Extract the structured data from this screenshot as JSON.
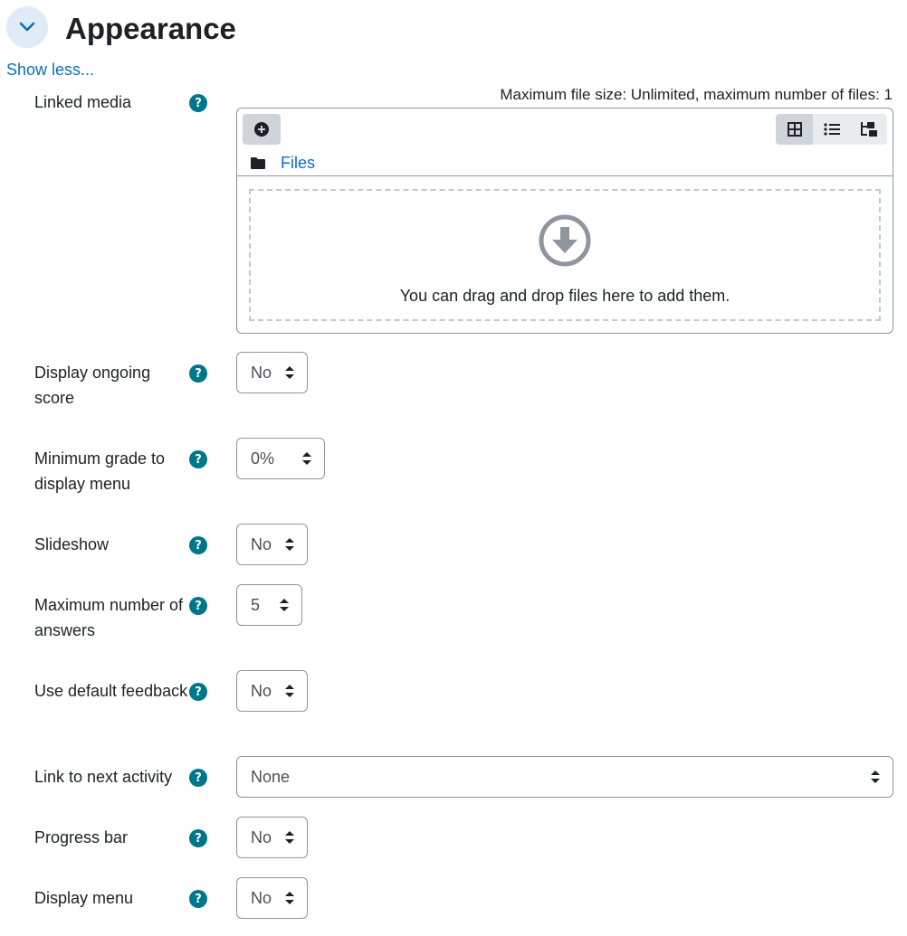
{
  "section": {
    "title": "Appearance",
    "show_less": "Show less...",
    "collapse_icon": "chevron-down-icon"
  },
  "linked_media": {
    "label": "Linked media",
    "max_info": "Maximum file size: Unlimited, maximum number of files: 1",
    "path_label": "Files",
    "drop_text": "You can drag and drop files here to add them.",
    "icons": [
      "add-file-icon",
      "grid-view-icon",
      "list-view-icon",
      "tree-view-icon",
      "folder-icon",
      "download-arrow-icon"
    ]
  },
  "fields": [
    {
      "label": "Display ongoing score",
      "value": "No"
    },
    {
      "label": "Minimum grade to display menu",
      "value": "0%"
    },
    {
      "label": "Slideshow",
      "value": "No"
    },
    {
      "label": "Maximum number of answers",
      "value": "5"
    },
    {
      "label": "Use default feedback",
      "value": "No"
    },
    {
      "label": "Link to next activity",
      "value": "None"
    },
    {
      "label": "Progress bar",
      "value": "No"
    },
    {
      "label": "Display menu",
      "value": "No"
    }
  ],
  "help_glyph": "?",
  "colors": {
    "link": "#0f6cbf",
    "help_icon": "#00768a",
    "collapse_bg": "#e0ebf8",
    "border": "#8f959e"
  }
}
